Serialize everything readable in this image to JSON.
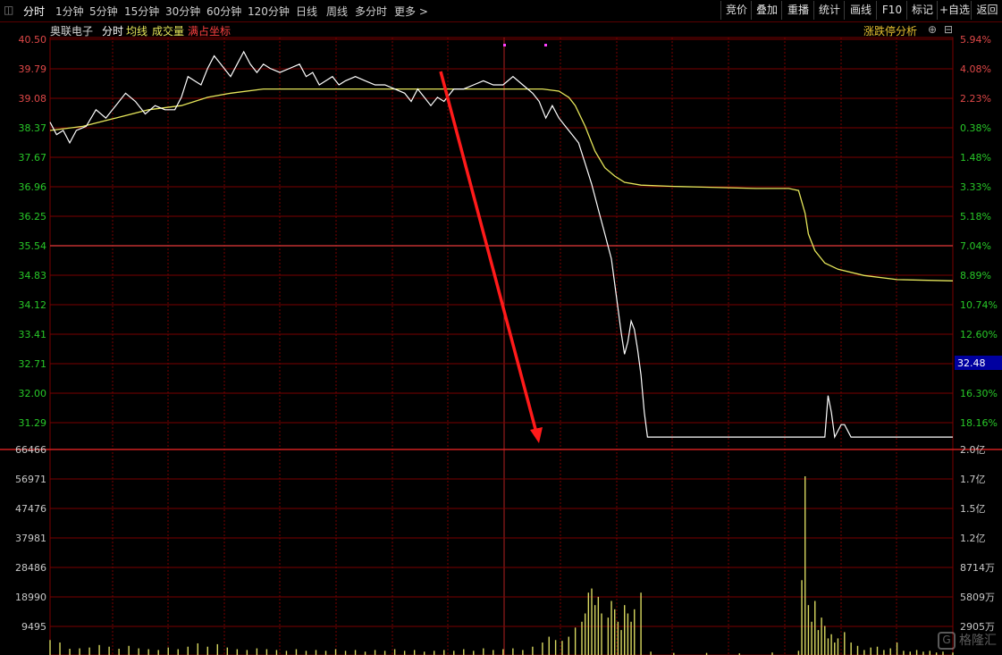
{
  "toolbar": {
    "tabs": [
      "分时",
      "1分钟",
      "5分钟",
      "15分钟",
      "30分钟",
      "60分钟",
      "120分钟",
      "日线",
      "周线",
      "多分时",
      "更多 >"
    ],
    "right_buttons": [
      "竞价",
      "叠加",
      "重播",
      "统计",
      "画线",
      "F10",
      "标记",
      "+自选",
      "返回"
    ]
  },
  "titlebar": {
    "stock_name": "奥联电子",
    "mode": "分时",
    "avg_line": "均线",
    "volume": "成交量",
    "full_scale": "满占坐标",
    "analysis": "涨跌停分析"
  },
  "colors": {
    "price_line": "#ffffff",
    "avg_line": "#e6e65a",
    "grid": "#7a0000",
    "axis_up": "#e04848",
    "axis_down": "#28c828",
    "arrow": "#ff1a1a",
    "volume": "#d8d860",
    "current_price_box": "#0000a0"
  },
  "chart_data": {
    "type": "line",
    "price_axis_left": [
      "40.50",
      "39.79",
      "39.08",
      "38.37",
      "37.67",
      "36.96",
      "36.25",
      "35.54",
      "34.83",
      "34.12",
      "33.41",
      "32.71",
      "32.00",
      "31.29"
    ],
    "pct_axis_right": [
      "5.94%",
      "4.08%",
      "2.23%",
      "0.38%",
      "1.48%",
      "3.33%",
      "5.18%",
      "7.04%",
      "8.89%",
      "10.74%",
      "12.60%",
      "14.45%",
      "16.30%",
      "18.16%"
    ],
    "volume_axis_left": [
      "66466",
      "56971",
      "47476",
      "37981",
      "28486",
      "18990",
      "9495"
    ],
    "volume_axis_right": [
      "2.0亿",
      "1.7亿",
      "1.5亿",
      "1.2亿",
      "8714万",
      "5809万",
      "2905万"
    ],
    "current_price": "32.48",
    "ylim": [
      30.6,
      40.5
    ],
    "prev_close": 38.08,
    "total_minutes": 240,
    "price": [
      [
        0,
        38.5
      ],
      [
        2,
        38.2
      ],
      [
        4,
        38.3
      ],
      [
        6,
        38.0
      ],
      [
        8,
        38.3
      ],
      [
        11,
        38.4
      ],
      [
        14,
        38.8
      ],
      [
        17,
        38.6
      ],
      [
        20,
        38.9
      ],
      [
        23,
        39.2
      ],
      [
        26,
        39.0
      ],
      [
        29,
        38.7
      ],
      [
        32,
        38.9
      ],
      [
        35,
        38.8
      ],
      [
        38,
        38.8
      ],
      [
        40,
        39.1
      ],
      [
        42,
        39.6
      ],
      [
        44,
        39.5
      ],
      [
        46,
        39.4
      ],
      [
        48,
        39.8
      ],
      [
        50,
        40.1
      ],
      [
        52,
        39.9
      ],
      [
        55,
        39.6
      ],
      [
        57,
        39.9
      ],
      [
        59,
        40.2
      ],
      [
        61,
        39.9
      ],
      [
        63,
        39.7
      ],
      [
        65,
        39.9
      ],
      [
        67,
        39.8
      ],
      [
        70,
        39.7
      ],
      [
        73,
        39.8
      ],
      [
        76,
        39.9
      ],
      [
        78,
        39.6
      ],
      [
        80,
        39.7
      ],
      [
        82,
        39.4
      ],
      [
        84,
        39.5
      ],
      [
        86,
        39.6
      ],
      [
        88,
        39.4
      ],
      [
        90,
        39.5
      ],
      [
        93,
        39.6
      ],
      [
        96,
        39.5
      ],
      [
        99,
        39.4
      ],
      [
        102,
        39.4
      ],
      [
        105,
        39.3
      ],
      [
        108,
        39.2
      ],
      [
        110,
        39.0
      ],
      [
        112,
        39.3
      ],
      [
        114,
        39.1
      ],
      [
        116,
        38.9
      ],
      [
        118,
        39.1
      ],
      [
        120,
        39.0
      ],
      [
        123,
        39.3
      ],
      [
        126,
        39.3
      ],
      [
        129,
        39.4
      ],
      [
        132,
        39.5
      ],
      [
        135,
        39.4
      ],
      [
        138,
        39.4
      ],
      [
        141,
        39.6
      ],
      [
        144,
        39.4
      ],
      [
        147,
        39.2
      ],
      [
        149,
        39.0
      ],
      [
        151,
        38.6
      ],
      [
        153,
        38.9
      ],
      [
        155,
        38.6
      ],
      [
        157,
        38.4
      ],
      [
        159,
        38.2
      ],
      [
        161,
        38.0
      ],
      [
        163,
        37.5
      ],
      [
        165,
        37.0
      ],
      [
        167,
        36.4
      ],
      [
        169,
        35.8
      ],
      [
        171,
        35.2
      ],
      [
        172,
        34.6
      ],
      [
        174,
        33.4
      ],
      [
        175,
        32.9
      ],
      [
        176,
        33.2
      ],
      [
        177,
        33.7
      ],
      [
        178,
        33.5
      ],
      [
        179,
        33.0
      ],
      [
        180,
        32.4
      ],
      [
        181,
        31.5
      ],
      [
        182,
        30.9
      ],
      [
        200,
        30.9
      ],
      [
        220,
        30.9
      ],
      [
        232,
        30.9
      ],
      [
        236,
        30.9
      ],
      [
        237,
        31.9
      ],
      [
        238,
        31.5
      ],
      [
        239,
        30.9
      ],
      [
        241,
        31.2
      ],
      [
        242,
        31.2
      ],
      [
        244,
        30.9
      ],
      [
        246,
        30.9
      ],
      [
        250,
        30.9
      ],
      [
        255,
        30.9
      ],
      [
        275,
        30.9
      ]
    ],
    "avg": [
      [
        0,
        38.3
      ],
      [
        10,
        38.4
      ],
      [
        20,
        38.6
      ],
      [
        30,
        38.8
      ],
      [
        40,
        38.9
      ],
      [
        48,
        39.1
      ],
      [
        55,
        39.2
      ],
      [
        65,
        39.3
      ],
      [
        80,
        39.3
      ],
      [
        100,
        39.3
      ],
      [
        130,
        39.3
      ],
      [
        150,
        39.3
      ],
      [
        155,
        39.25
      ],
      [
        158,
        39.1
      ],
      [
        160,
        38.9
      ],
      [
        163,
        38.4
      ],
      [
        166,
        37.8
      ],
      [
        169,
        37.4
      ],
      [
        172,
        37.2
      ],
      [
        175,
        37.05
      ],
      [
        180,
        36.98
      ],
      [
        190,
        36.95
      ],
      [
        200,
        36.93
      ],
      [
        215,
        36.9
      ],
      [
        225,
        36.9
      ],
      [
        228,
        36.85
      ],
      [
        230,
        36.3
      ],
      [
        231,
        35.8
      ],
      [
        233,
        35.4
      ],
      [
        236,
        35.1
      ],
      [
        240,
        34.95
      ],
      [
        248,
        34.8
      ],
      [
        258,
        34.7
      ],
      [
        275,
        34.67
      ]
    ],
    "volume": [
      [
        0,
        0.36
      ],
      [
        3,
        0.3
      ],
      [
        6,
        0.15
      ],
      [
        9,
        0.16
      ],
      [
        12,
        0.18
      ],
      [
        15,
        0.24
      ],
      [
        18,
        0.2
      ],
      [
        21,
        0.15
      ],
      [
        24,
        0.22
      ],
      [
        27,
        0.16
      ],
      [
        30,
        0.14
      ],
      [
        33,
        0.12
      ],
      [
        36,
        0.18
      ],
      [
        39,
        0.14
      ],
      [
        42,
        0.2
      ],
      [
        45,
        0.28
      ],
      [
        48,
        0.2
      ],
      [
        51,
        0.26
      ],
      [
        54,
        0.18
      ],
      [
        57,
        0.14
      ],
      [
        60,
        0.12
      ],
      [
        63,
        0.16
      ],
      [
        66,
        0.14
      ],
      [
        69,
        0.12
      ],
      [
        72,
        0.1
      ],
      [
        75,
        0.14
      ],
      [
        78,
        0.1
      ],
      [
        81,
        0.12
      ],
      [
        84,
        0.1
      ],
      [
        87,
        0.14
      ],
      [
        90,
        0.1
      ],
      [
        93,
        0.12
      ],
      [
        96,
        0.08
      ],
      [
        99,
        0.12
      ],
      [
        102,
        0.1
      ],
      [
        105,
        0.14
      ],
      [
        108,
        0.1
      ],
      [
        111,
        0.12
      ],
      [
        114,
        0.08
      ],
      [
        117,
        0.1
      ],
      [
        120,
        0.12
      ],
      [
        123,
        0.1
      ],
      [
        126,
        0.14
      ],
      [
        129,
        0.1
      ],
      [
        132,
        0.16
      ],
      [
        135,
        0.12
      ],
      [
        138,
        0.14
      ],
      [
        141,
        0.16
      ],
      [
        144,
        0.12
      ],
      [
        147,
        0.2
      ],
      [
        150,
        0.3
      ],
      [
        152,
        0.44
      ],
      [
        154,
        0.36
      ],
      [
        156,
        0.34
      ],
      [
        158,
        0.44
      ],
      [
        160,
        0.66
      ],
      [
        162,
        0.8
      ],
      [
        163,
        1.0
      ],
      [
        164,
        1.5
      ],
      [
        165,
        1.6
      ],
      [
        166,
        1.2
      ],
      [
        167,
        1.4
      ],
      [
        168,
        1.0
      ],
      [
        170,
        0.9
      ],
      [
        171,
        1.3
      ],
      [
        172,
        1.1
      ],
      [
        173,
        0.8
      ],
      [
        174,
        0.6
      ],
      [
        175,
        1.2
      ],
      [
        176,
        1.0
      ],
      [
        177,
        0.8
      ],
      [
        178,
        1.1
      ],
      [
        180,
        1.5
      ],
      [
        183,
        0.08
      ],
      [
        190,
        0.05
      ],
      [
        200,
        0.05
      ],
      [
        210,
        0.04
      ],
      [
        220,
        0.06
      ],
      [
        228,
        0.1
      ],
      [
        229,
        1.8
      ],
      [
        230,
        4.3
      ],
      [
        231,
        1.2
      ],
      [
        232,
        0.8
      ],
      [
        233,
        1.3
      ],
      [
        234,
        0.6
      ],
      [
        235,
        0.9
      ],
      [
        236,
        0.7
      ],
      [
        237,
        0.4
      ],
      [
        238,
        0.5
      ],
      [
        239,
        0.3
      ],
      [
        240,
        0.4
      ],
      [
        242,
        0.55
      ],
      [
        244,
        0.3
      ],
      [
        246,
        0.22
      ],
      [
        248,
        0.12
      ],
      [
        250,
        0.18
      ],
      [
        252,
        0.2
      ],
      [
        254,
        0.12
      ],
      [
        256,
        0.16
      ],
      [
        258,
        0.3
      ],
      [
        260,
        0.1
      ],
      [
        262,
        0.08
      ],
      [
        264,
        0.12
      ],
      [
        266,
        0.08
      ],
      [
        268,
        0.1
      ],
      [
        270,
        0.06
      ],
      [
        272,
        0.08
      ],
      [
        275,
        0.06
      ]
    ]
  },
  "watermark": "格隆汇",
  "watermark_logo": "G"
}
